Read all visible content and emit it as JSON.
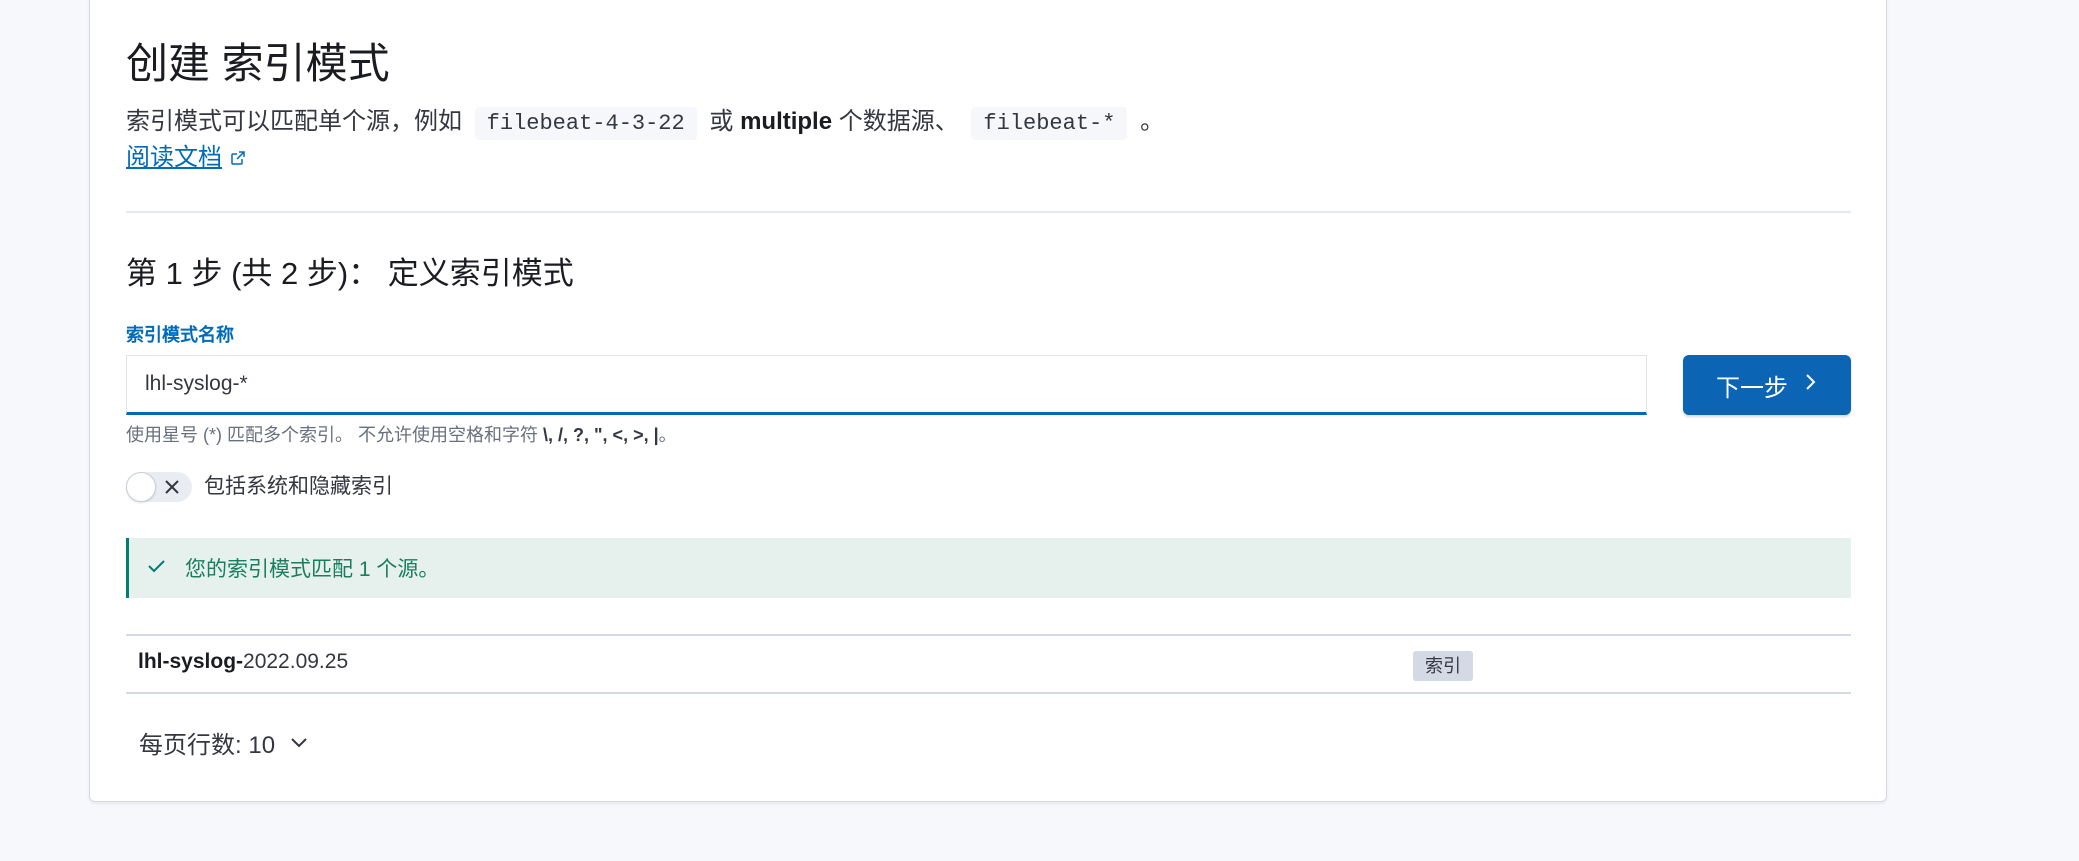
{
  "header": {
    "title": "创建 索引模式",
    "description": {
      "part1": "索引模式可以匹配单个源，例如",
      "example_single": "filebeat-4-3-22",
      "part2": "或",
      "multiple": "multiple",
      "part3": "个数据源、",
      "example_multi": "filebeat-*",
      "part4": "。"
    },
    "docs_link": "阅读文档"
  },
  "step": {
    "title": "第 1 步 (共 2 步)： 定义索引模式",
    "field_label": "索引模式名称",
    "input_value": "lhl-syslog-*",
    "next_button": "下一步",
    "help_prefix": "使用星号 (*) 匹配多个索引。 不允许使用空格和字符",
    "help_chars": "\\, /, ?, \", <, >, |",
    "help_suffix": "。"
  },
  "toggle": {
    "label": "包括系统和隐藏索引",
    "checked": false
  },
  "callout": {
    "message": "您的索引模式匹配 1 个源。",
    "color": "#017d73"
  },
  "results": {
    "rows": [
      {
        "name_bold": "lhl-syslog-",
        "name_rest": "2022.09.25",
        "badge": "索引"
      }
    ]
  },
  "pagination": {
    "label": "每页行数",
    "value": "10"
  },
  "colors": {
    "primary": "#0b64b4",
    "link": "#006bb8",
    "success": "#017d73"
  }
}
